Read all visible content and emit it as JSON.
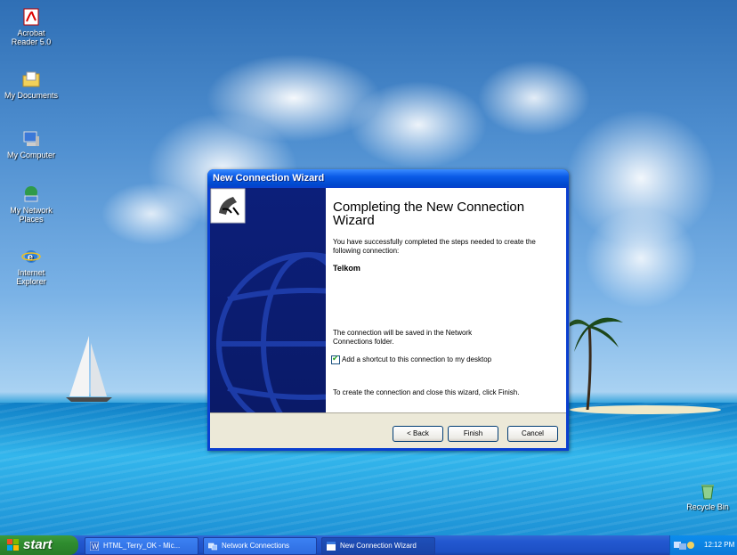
{
  "desktop": {
    "icons": [
      {
        "label": "Acrobat Reader 5.0",
        "icon": "acrobat-reader-icon"
      },
      {
        "label": "My Documents",
        "icon": "my-documents-folder-icon"
      },
      {
        "label": "My Computer",
        "icon": "my-computer-icon"
      },
      {
        "label": "My Network Places",
        "icon": "network-places-icon"
      },
      {
        "label": "Internet Explorer",
        "icon": "internet-explorer-icon"
      }
    ],
    "recycle_bin": {
      "label": "Recycle Bin",
      "icon": "recycle-bin-icon"
    }
  },
  "wizard": {
    "title": "New Connection Wizard",
    "heading": "Completing the New Connection Wizard",
    "intro": "You have successfully completed the steps needed to create the following connection:",
    "connection_name": "Telkom",
    "saved_note": "The connection will be saved in the Network Connections folder.",
    "shortcut_label": "Add a shortcut to this connection to my desktop",
    "shortcut_checked": true,
    "finish_note": "To create the connection and close this wizard, click Finish.",
    "buttons": {
      "back": "< Back",
      "finish": "Finish",
      "cancel": "Cancel"
    },
    "icon": "connection-wizard-icon"
  },
  "taskbar": {
    "start_label": "start",
    "tasks": [
      {
        "label": "HTML_Terry_OK - Mic...",
        "icon": "word-document-icon"
      },
      {
        "label": "Network Connections",
        "icon": "network-connections-icon"
      },
      {
        "label": "New Connection Wizard",
        "icon": "wizard-window-icon",
        "active": true
      }
    ],
    "clock": "12:12 PM"
  },
  "colors": {
    "titlebar": "#0a5ae6",
    "taskbar": "#2358d0",
    "start_button": "#2f8c2f",
    "dialog_face": "#ece9d8",
    "sidebar": "#0c1f7a"
  }
}
